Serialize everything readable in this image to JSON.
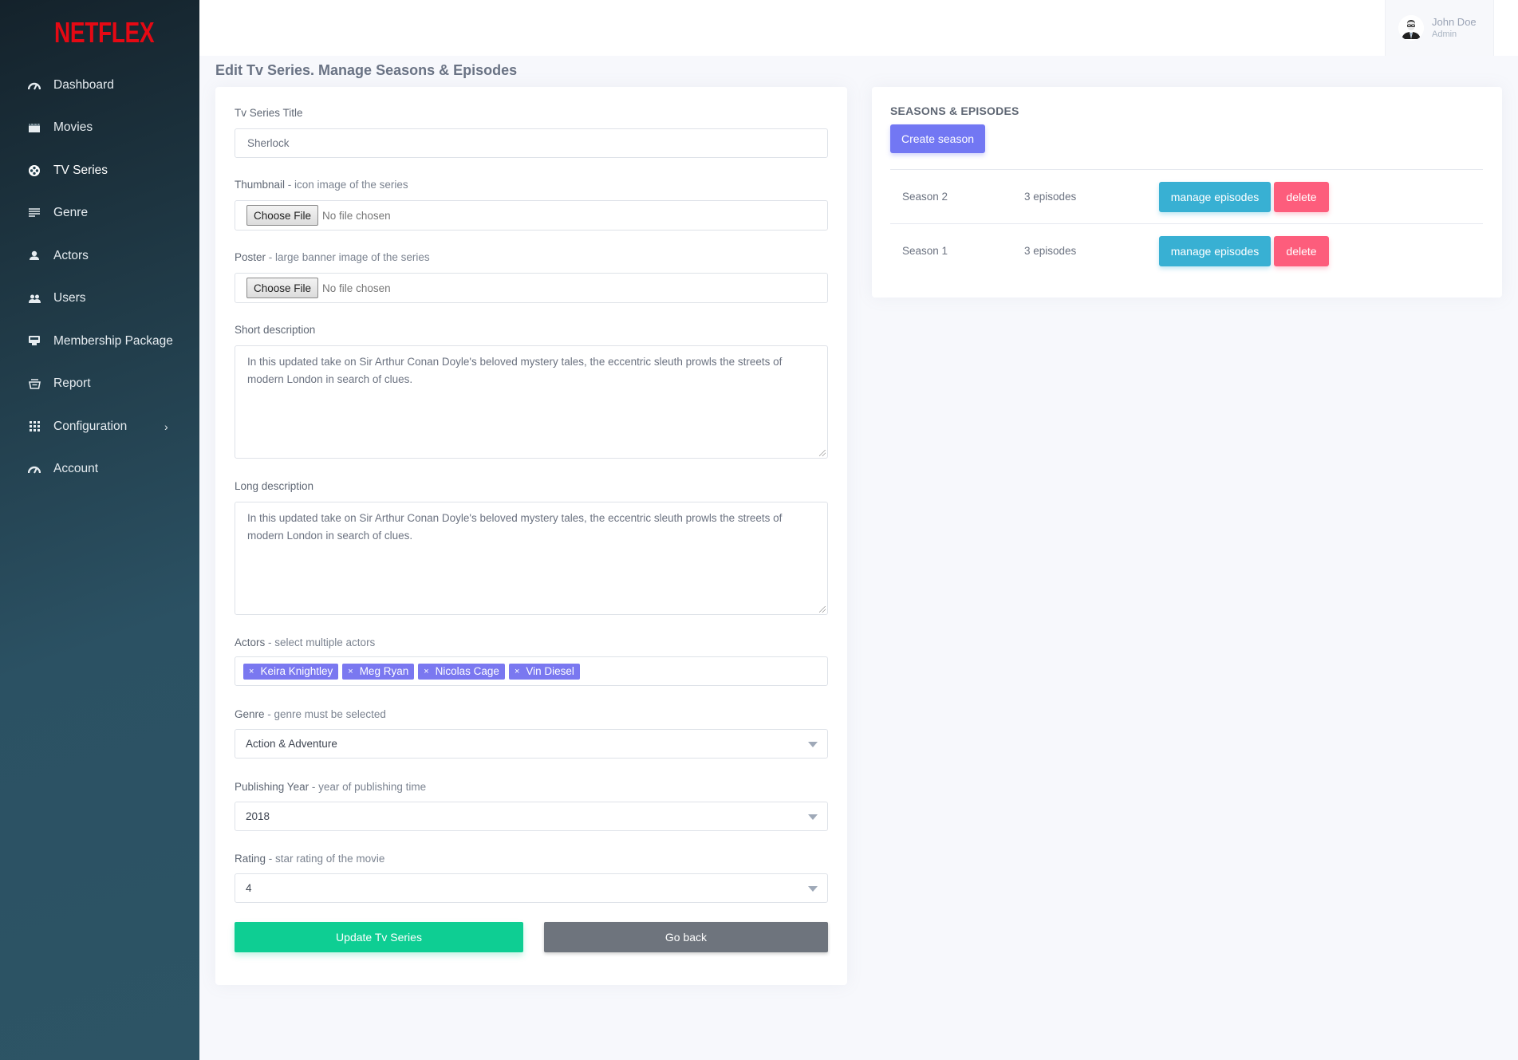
{
  "brand": {
    "logo_text": "NETFLEX",
    "logo_color": "#e50914"
  },
  "sidebar": {
    "items": [
      {
        "label": "Dashboard",
        "icon": "gauge-icon",
        "active": false
      },
      {
        "label": "Movies",
        "icon": "clapperboard-icon",
        "active": false
      },
      {
        "label": "TV Series",
        "icon": "film-reel-icon",
        "active": true
      },
      {
        "label": "Genre",
        "icon": "list-lines-icon",
        "active": false
      },
      {
        "label": "Actors",
        "icon": "person-icon",
        "active": false
      },
      {
        "label": "Users",
        "icon": "users-icon",
        "active": false
      },
      {
        "label": "Membership Package",
        "icon": "monitor-icon",
        "active": false
      },
      {
        "label": "Report",
        "icon": "basket-icon",
        "active": false
      },
      {
        "label": "Configuration",
        "icon": "grid-dots-icon",
        "active": false,
        "has_submenu": true
      },
      {
        "label": "Account",
        "icon": "gauge-icon",
        "active": false
      }
    ]
  },
  "user": {
    "name": "John Doe",
    "role": "Admin"
  },
  "page": {
    "title": "Edit Tv Series. Manage Seasons & Episodes"
  },
  "form": {
    "title_field": {
      "label": "Tv Series Title",
      "value": "Sherlock"
    },
    "thumbnail": {
      "label": "Thumbnail",
      "hint": " - icon image of the series",
      "button": "Choose File",
      "status": "No file chosen"
    },
    "poster": {
      "label": "Poster",
      "hint": " - large banner image of the series",
      "button": "Choose File",
      "status": "No file chosen"
    },
    "short_description": {
      "label": "Short description",
      "value": "In this updated take on Sir Arthur Conan Doyle's beloved mystery tales, the eccentric sleuth prowls the streets of modern London in search of clues."
    },
    "long_description": {
      "label": "Long description",
      "value": "In this updated take on Sir Arthur Conan Doyle's beloved mystery tales, the eccentric sleuth prowls the streets of modern London in search of clues."
    },
    "actors": {
      "label": "Actors",
      "hint": " - select multiple actors",
      "selected": [
        "Keira Knightley",
        "Meg Ryan",
        "Nicolas Cage",
        "Vin Diesel"
      ],
      "remove_glyph": "×"
    },
    "genre": {
      "label": "Genre",
      "hint": " - genre must be selected",
      "value": "Action & Adventure"
    },
    "year": {
      "label": "Publishing Year",
      "hint": " - year of publishing time",
      "value": "2018"
    },
    "rating": {
      "label": "Rating",
      "hint": " - star rating of the movie",
      "value": "4"
    },
    "update_button": "Update Tv Series",
    "back_button": "Go back"
  },
  "seasons_panel": {
    "title": "SEASONS & EPISODES",
    "create_button": "Create season",
    "seasons": [
      {
        "name": "Season 2",
        "episodes": "3 episodes",
        "manage_label": "manage episodes",
        "delete_label": "delete"
      },
      {
        "name": "Season 1",
        "episodes": "3 episodes",
        "manage_label": "manage episodes",
        "delete_label": "delete"
      }
    ]
  },
  "colors": {
    "update": "#0ece93",
    "back": "#6e747d",
    "create": "#7277f3",
    "manage": "#38b0d3",
    "delete": "#fd5d7c",
    "tag": "#7a78f0"
  }
}
